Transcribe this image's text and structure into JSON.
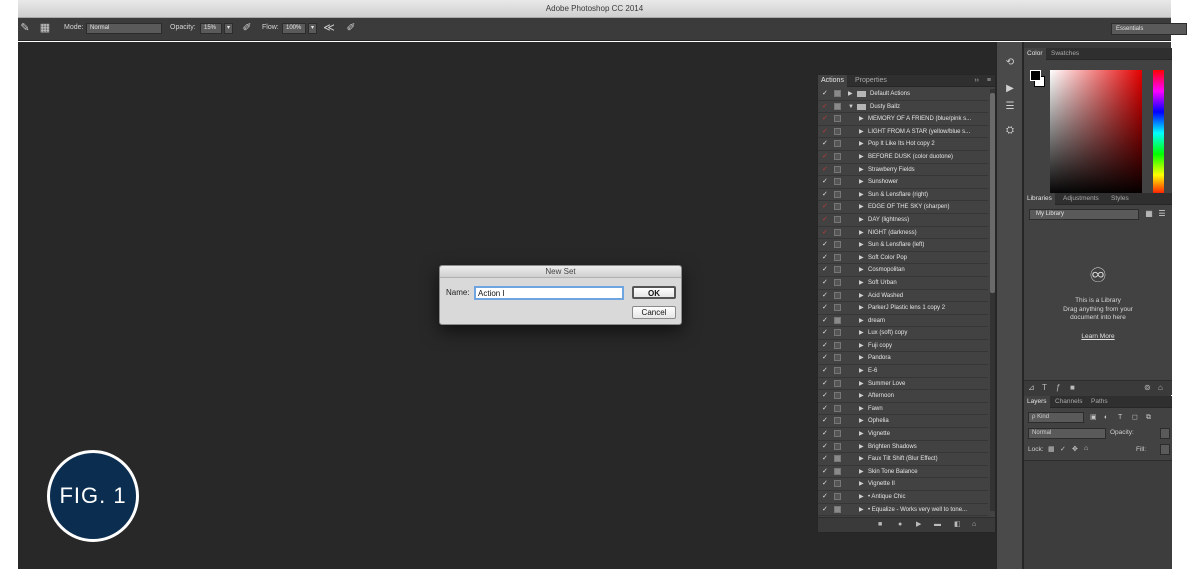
{
  "window": {
    "title": "Adobe Photoshop CC 2014"
  },
  "options_bar": {
    "mode_label": "Mode:",
    "mode_value": "Normal",
    "opacity_label": "Opacity:",
    "opacity_value": "15%",
    "flow_label": "Flow:",
    "flow_value": "100%",
    "workspace": "Essentials"
  },
  "dialog": {
    "title": "New Set",
    "name_label": "Name:",
    "name_value": "Action I",
    "ok_label": "OK",
    "cancel_label": "Cancel"
  },
  "fig_label": "FIG. 1",
  "actions_panel": {
    "tabs": [
      "Actions",
      "Properties"
    ],
    "menu_glyph": "››",
    "items": [
      {
        "label": "Default Actions",
        "level": 0,
        "type": "set",
        "check": "white",
        "dialog": true
      },
      {
        "label": "Dusty Ballz",
        "level": 0,
        "type": "set-open",
        "check": "red",
        "dialog": true
      },
      {
        "label": "MEMORY OF A FRIEND (blue/pink s...",
        "level": 1,
        "type": "action",
        "check": "red",
        "dialog": false
      },
      {
        "label": "LIGHT FROM A STAR (yellow/blue s...",
        "level": 1,
        "type": "action",
        "check": "red",
        "dialog": false
      },
      {
        "label": "Pop It Like Its Hot copy 2",
        "level": 1,
        "type": "action",
        "check": "white",
        "dialog": false
      },
      {
        "label": "BEFORE DUSK (color duotone)",
        "level": 1,
        "type": "action",
        "check": "red",
        "dialog": false
      },
      {
        "label": "Strawberry Fields",
        "level": 1,
        "type": "action",
        "check": "red",
        "dialog": false
      },
      {
        "label": "Sunshower",
        "level": 1,
        "type": "action",
        "check": "white",
        "dialog": false
      },
      {
        "label": "Sun & Lensflare (right)",
        "level": 1,
        "type": "action",
        "check": "white",
        "dialog": false
      },
      {
        "label": "EDGE OF THE SKY (sharpen)",
        "level": 1,
        "type": "action",
        "check": "red",
        "dialog": false
      },
      {
        "label": "DAY (lightness)",
        "level": 1,
        "type": "action",
        "check": "red",
        "dialog": false
      },
      {
        "label": "NIGHT (darkness)",
        "level": 1,
        "type": "action",
        "check": "red",
        "dialog": false
      },
      {
        "label": "Sun & Lensflare (left)",
        "level": 1,
        "type": "action",
        "check": "white",
        "dialog": false
      },
      {
        "label": "Soft Color Pop",
        "level": 1,
        "type": "action",
        "check": "white",
        "dialog": false
      },
      {
        "label": "Cosmopolitan",
        "level": 1,
        "type": "action",
        "check": "white",
        "dialog": false
      },
      {
        "label": "Soft Urban",
        "level": 1,
        "type": "action",
        "check": "white",
        "dialog": false
      },
      {
        "label": "Acid Washed",
        "level": 1,
        "type": "action",
        "check": "white",
        "dialog": false
      },
      {
        "label": "ParkerJ Plastic lens 1 copy 2",
        "level": 1,
        "type": "action",
        "check": "white",
        "dialog": false
      },
      {
        "label": "dream",
        "level": 1,
        "type": "action",
        "check": "white",
        "dialog": true
      },
      {
        "label": "Lux (soft) copy",
        "level": 1,
        "type": "action",
        "check": "white",
        "dialog": false
      },
      {
        "label": "Fuji copy",
        "level": 1,
        "type": "action",
        "check": "white",
        "dialog": false
      },
      {
        "label": "Pandora",
        "level": 1,
        "type": "action",
        "check": "white",
        "dialog": false
      },
      {
        "label": "E-6",
        "level": 1,
        "type": "action",
        "check": "white",
        "dialog": false
      },
      {
        "label": "Summer Love",
        "level": 1,
        "type": "action",
        "check": "white",
        "dialog": false
      },
      {
        "label": "Afternoon",
        "level": 1,
        "type": "action",
        "check": "white",
        "dialog": false
      },
      {
        "label": "Fawn",
        "level": 1,
        "type": "action",
        "check": "white",
        "dialog": false
      },
      {
        "label": "Ophelia",
        "level": 1,
        "type": "action",
        "check": "white",
        "dialog": false
      },
      {
        "label": "Vignette",
        "level": 1,
        "type": "action",
        "check": "white",
        "dialog": false
      },
      {
        "label": "Brighten Shadows",
        "level": 1,
        "type": "action",
        "check": "white",
        "dialog": false
      },
      {
        "label": "Faux Tilt Shift (Blur Effect)",
        "level": 1,
        "type": "action",
        "check": "white",
        "dialog": true
      },
      {
        "label": "Skin Tone Balance",
        "level": 1,
        "type": "action",
        "check": "white",
        "dialog": true
      },
      {
        "label": "Vignette II",
        "level": 1,
        "type": "action",
        "check": "white",
        "dialog": false
      },
      {
        "label": "• Antique Chic",
        "level": 1,
        "type": "action",
        "check": "white",
        "dialog": false
      },
      {
        "label": "• Equalize - Works very well to tone...",
        "level": 1,
        "type": "action",
        "check": "white",
        "dialog": true
      }
    ]
  },
  "color_panel": {
    "tabs": [
      "Color",
      "Swatches"
    ]
  },
  "libraries_panel": {
    "tabs": [
      "Libraries",
      "Adjustments",
      "Styles"
    ],
    "library_select": "My Library",
    "empty_text_1": "This is a Library",
    "empty_text_2": "Drag anything from your",
    "empty_text_3": "document into here",
    "learn_more": "Learn More"
  },
  "layers_panel": {
    "tabs": [
      "Layers",
      "Channels",
      "Paths"
    ],
    "kind_label": "ρ Kind",
    "blend_mode": "Normal",
    "opacity_label": "Opacity:",
    "lock_label": "Lock:",
    "fill_label": "Fill:"
  },
  "colors": {
    "badge": "#0b2e50",
    "canvas": "#282828",
    "panel": "#424242"
  }
}
